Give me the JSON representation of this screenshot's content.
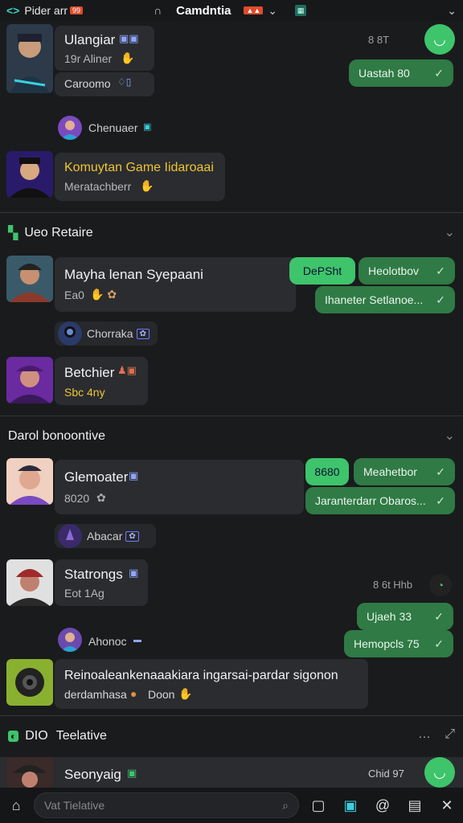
{
  "topbar": {
    "left_label": "Pider arr",
    "title": "Camdntia",
    "chevron": "chevron-down-icon"
  },
  "chats": {
    "c1": {
      "name": "Ulangiar",
      "sub": "19r Aliner",
      "pill_text": "Uastah 80",
      "ts": "8 8T"
    },
    "c1b": {
      "name": "Caroomo"
    },
    "chip1": {
      "label": "Chenuaer"
    },
    "c2": {
      "name": "Komuytan Game Iidaroaai",
      "sub": "Meratachberr"
    }
  },
  "sections": {
    "s1": "Ueo Retaire",
    "s2": "Darol bonoontive",
    "s3": "Teelative",
    "s3_prefix": "DIO"
  },
  "group1": {
    "c3": {
      "name": "Mayha lenan Syepaani",
      "sub": "Ea0",
      "pill_a": "DePSht",
      "pill_b": "Heolotbov",
      "pill_c": "Ihaneter Setlanoe..."
    },
    "chip2": {
      "label": "Chorraka"
    },
    "c4": {
      "name": "Betchier",
      "sub": "Sbc 4ny"
    }
  },
  "group2": {
    "c5": {
      "name": "Glemoater",
      "sub": "8020",
      "pill_a": "8680",
      "pill_b": "Meahetbor",
      "pill_c": "Jaranterdarr Obaros..."
    },
    "chip3": {
      "label": "Abacar"
    },
    "c6": {
      "name": "Statrongs",
      "sub": "Eot 1Ag",
      "ts": "8 6t Hhb",
      "pill_a": "Ujaeh 33",
      "pill_b": "Hemopcls 75"
    },
    "chip4": {
      "label": "Ahonoc"
    },
    "c7": {
      "line1": "Reinoaleankenaaakiara ingarsai-pardar sigonon",
      "line2": "derdamhasa",
      "line2b": "Doon"
    }
  },
  "group3": {
    "c8": {
      "name": "Seonyaig",
      "ts": "Chid 97"
    }
  },
  "bottom": {
    "search_placeholder": "Vat Tielative"
  },
  "colors": {
    "accent": "#3ec46b",
    "bubble": "#2f7a45",
    "bg": "#1a1b1d"
  }
}
